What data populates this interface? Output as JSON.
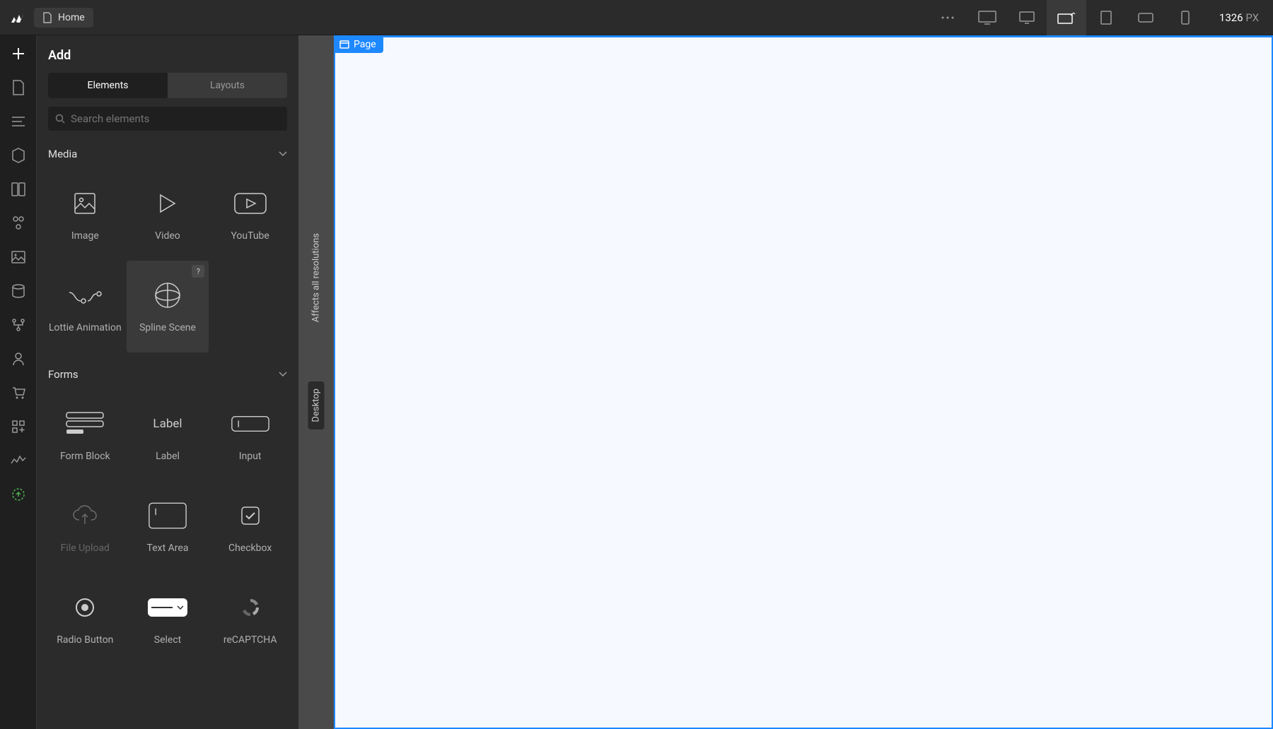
{
  "topbar": {
    "home": "Home",
    "width": "1326",
    "unit": "PX"
  },
  "panel": {
    "title": "Add",
    "tabs": {
      "elements": "Elements",
      "layouts": "Layouts"
    },
    "search_placeholder": "Search elements"
  },
  "sections": {
    "media": {
      "title": "Media",
      "items": [
        "Image",
        "Video",
        "YouTube",
        "Lottie Animation",
        "Spline Scene"
      ]
    },
    "forms": {
      "title": "Forms",
      "items": [
        "Form Block",
        "Label",
        "Input",
        "File Upload",
        "Text Area",
        "Checkbox",
        "Radio Button",
        "Select",
        "reCAPTCHA"
      ]
    }
  },
  "canvas": {
    "resolutions_label": "Affects all resolutions",
    "breakpoint": "Desktop",
    "page_badge": "Page"
  },
  "label_text": "Label"
}
